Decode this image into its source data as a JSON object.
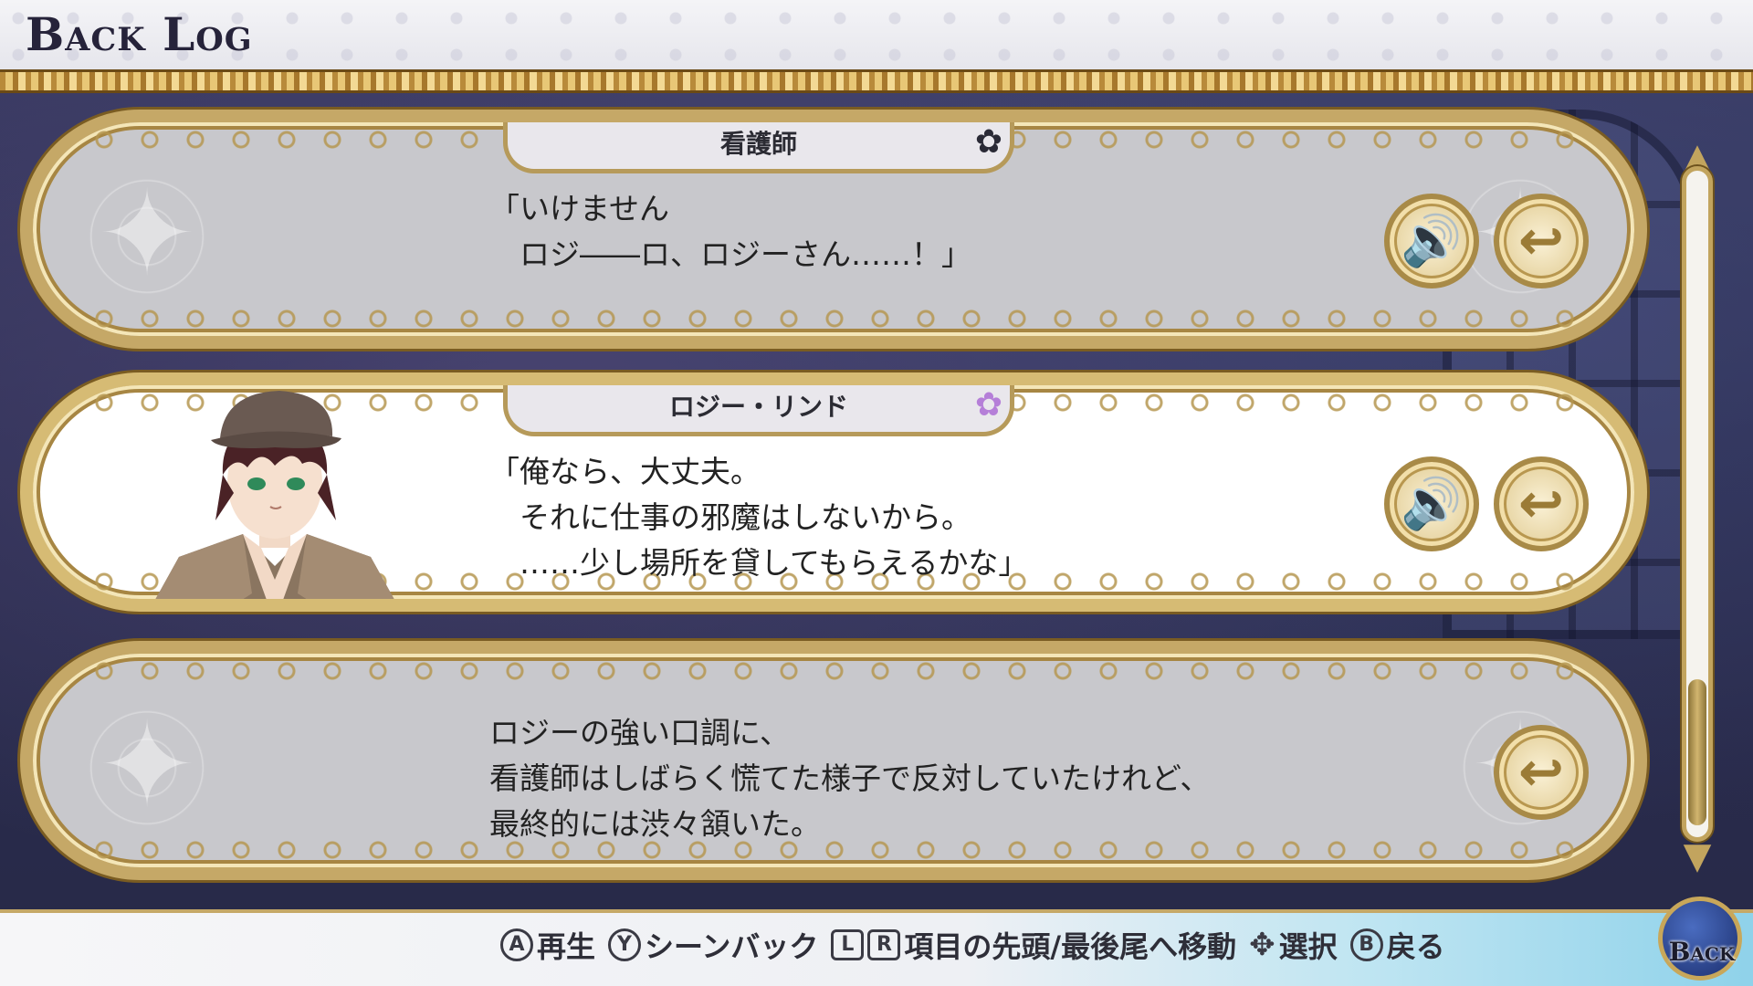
{
  "header": {
    "title": "Back Log"
  },
  "entries": [
    {
      "speaker": "看護師",
      "text": "「いけません\n　ロジ――ロ、ロジーさん……！」",
      "has_voice": true,
      "active": false
    },
    {
      "speaker": "ロジー・リンド",
      "text": "「俺なら、大丈夫。\n　それに仕事の邪魔はしないから。\n　……少し場所を貸してもらえるかな」",
      "has_voice": true,
      "active": true
    },
    {
      "speaker": "",
      "text": "ロジーの強い口調に、\n看護師はしばらく慌てた様子で反対していたけれど、\n最終的には渋々頷いた。",
      "has_voice": false,
      "active": false
    }
  ],
  "icons": {
    "voice": "speaker-icon",
    "jump": "return-arrow-icon",
    "rose": "rose-icon"
  },
  "footer": {
    "hints": [
      {
        "glyph": "A",
        "label": "再生"
      },
      {
        "glyph": "Y",
        "label": "シーンバック"
      },
      {
        "glyph_l": "L",
        "glyph_r": "R",
        "label": "項目の先頭/最後尾へ移動"
      },
      {
        "glyph": "dpad",
        "label": "選択"
      },
      {
        "glyph": "B",
        "label": "戻る"
      }
    ],
    "back_label": "Back"
  },
  "scrollbar": {
    "position": 0.92
  },
  "colors": {
    "gold": "#c5a867",
    "active_bg": "#ffffff",
    "inactive_bg": "#c8c8cc",
    "footer_accent": "#8fd2ea"
  }
}
